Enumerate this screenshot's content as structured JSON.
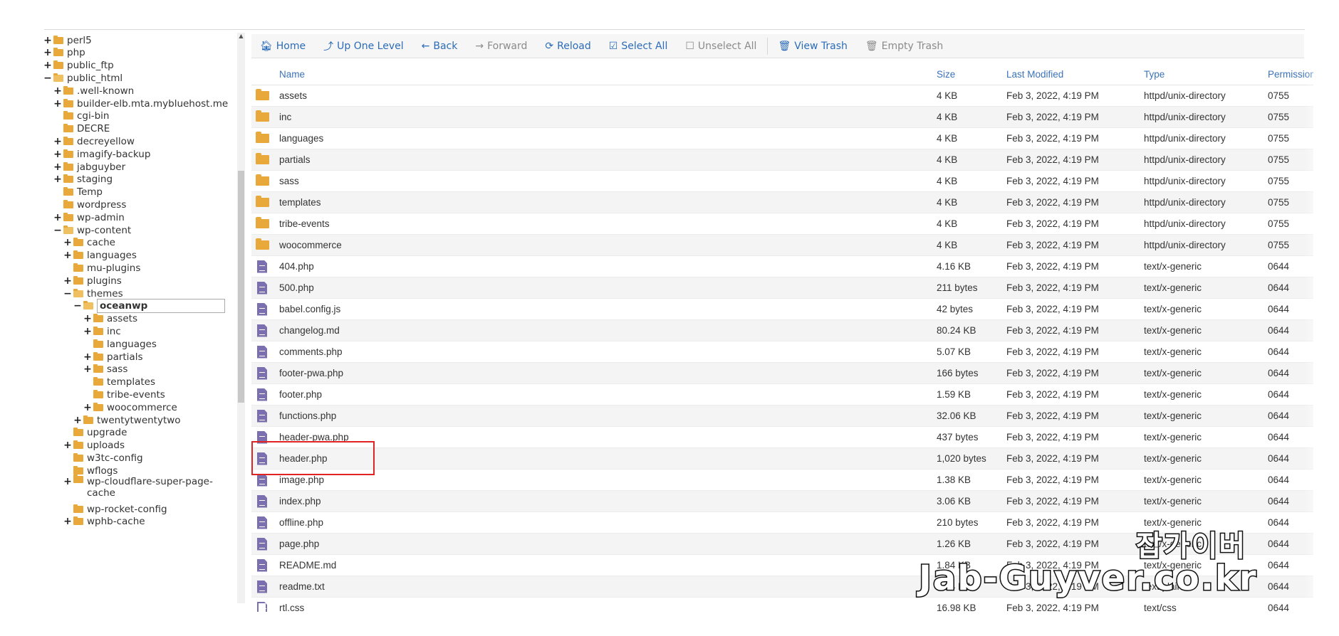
{
  "sidebar": {
    "tree": [
      {
        "label": "perl5",
        "toggle": "+",
        "depth": 0
      },
      {
        "label": "php",
        "toggle": "+",
        "depth": 0
      },
      {
        "label": "public_ftp",
        "toggle": "+",
        "depth": 0
      },
      {
        "label": "public_html",
        "toggle": "−",
        "depth": 0,
        "open": true
      },
      {
        "label": ".well-known",
        "toggle": "+",
        "depth": 1
      },
      {
        "label": "builder-elb.mta.mybluehost.me",
        "toggle": "+",
        "depth": 1
      },
      {
        "label": "cgi-bin",
        "toggle": "",
        "depth": 1
      },
      {
        "label": "DECRE",
        "toggle": "",
        "depth": 1
      },
      {
        "label": "decreyellow",
        "toggle": "+",
        "depth": 1
      },
      {
        "label": "imagify-backup",
        "toggle": "+",
        "depth": 1
      },
      {
        "label": "jabguyber",
        "toggle": "+",
        "depth": 1
      },
      {
        "label": "staging",
        "toggle": "+",
        "depth": 1
      },
      {
        "label": "Temp",
        "toggle": "",
        "depth": 1
      },
      {
        "label": "wordpress",
        "toggle": "",
        "depth": 1
      },
      {
        "label": "wp-admin",
        "toggle": "+",
        "depth": 1
      },
      {
        "label": "wp-content",
        "toggle": "−",
        "depth": 1,
        "open": true
      },
      {
        "label": "cache",
        "toggle": "+",
        "depth": 2
      },
      {
        "label": "languages",
        "toggle": "+",
        "depth": 2
      },
      {
        "label": "mu-plugins",
        "toggle": "",
        "depth": 2
      },
      {
        "label": "plugins",
        "toggle": "+",
        "depth": 2
      },
      {
        "label": "themes",
        "toggle": "−",
        "depth": 2,
        "open": true
      },
      {
        "label": "oceanwp",
        "toggle": "−",
        "depth": 3,
        "open": true,
        "selected": true
      },
      {
        "label": "assets",
        "toggle": "+",
        "depth": 4
      },
      {
        "label": "inc",
        "toggle": "+",
        "depth": 4
      },
      {
        "label": "languages",
        "toggle": "",
        "depth": 4
      },
      {
        "label": "partials",
        "toggle": "+",
        "depth": 4
      },
      {
        "label": "sass",
        "toggle": "+",
        "depth": 4
      },
      {
        "label": "templates",
        "toggle": "",
        "depth": 4
      },
      {
        "label": "tribe-events",
        "toggle": "",
        "depth": 4
      },
      {
        "label": "woocommerce",
        "toggle": "+",
        "depth": 4
      },
      {
        "label": "twentytwentytwo",
        "toggle": "+",
        "depth": 3
      },
      {
        "label": "upgrade",
        "toggle": "",
        "depth": 2
      },
      {
        "label": "uploads",
        "toggle": "+",
        "depth": 2
      },
      {
        "label": "w3tc-config",
        "toggle": "",
        "depth": 2
      },
      {
        "label": "wflogs",
        "toggle": "",
        "depth": 2
      },
      {
        "label": "wp-cloudflare-super-page-cache",
        "toggle": "+",
        "depth": 2,
        "two_line": true
      },
      {
        "label": "wp-rocket-config",
        "toggle": "",
        "depth": 2
      },
      {
        "label": "wphb-cache",
        "toggle": "+",
        "depth": 2
      }
    ]
  },
  "toolbar": {
    "home": "Home",
    "up": "Up One Level",
    "back": "Back",
    "forward": "Forward",
    "reload": "Reload",
    "select_all": "Select All",
    "unselect_all": "Unselect All",
    "view_trash": "View Trash",
    "empty_trash": "Empty Trash"
  },
  "table": {
    "headers": {
      "name": "Name",
      "size": "Size",
      "modified": "Last Modified",
      "type": "Type",
      "perm": "Permissions"
    },
    "rows": [
      {
        "kind": "dir",
        "name": "assets",
        "size": "4 KB",
        "modified": "Feb 3, 2022, 4:19 PM",
        "type": "httpd/unix-directory",
        "perm": "0755"
      },
      {
        "kind": "dir",
        "name": "inc",
        "size": "4 KB",
        "modified": "Feb 3, 2022, 4:19 PM",
        "type": "httpd/unix-directory",
        "perm": "0755"
      },
      {
        "kind": "dir",
        "name": "languages",
        "size": "4 KB",
        "modified": "Feb 3, 2022, 4:19 PM",
        "type": "httpd/unix-directory",
        "perm": "0755"
      },
      {
        "kind": "dir",
        "name": "partials",
        "size": "4 KB",
        "modified": "Feb 3, 2022, 4:19 PM",
        "type": "httpd/unix-directory",
        "perm": "0755"
      },
      {
        "kind": "dir",
        "name": "sass",
        "size": "4 KB",
        "modified": "Feb 3, 2022, 4:19 PM",
        "type": "httpd/unix-directory",
        "perm": "0755"
      },
      {
        "kind": "dir",
        "name": "templates",
        "size": "4 KB",
        "modified": "Feb 3, 2022, 4:19 PM",
        "type": "httpd/unix-directory",
        "perm": "0755"
      },
      {
        "kind": "dir",
        "name": "tribe-events",
        "size": "4 KB",
        "modified": "Feb 3, 2022, 4:19 PM",
        "type": "httpd/unix-directory",
        "perm": "0755"
      },
      {
        "kind": "dir",
        "name": "woocommerce",
        "size": "4 KB",
        "modified": "Feb 3, 2022, 4:19 PM",
        "type": "httpd/unix-directory",
        "perm": "0755"
      },
      {
        "kind": "file",
        "name": "404.php",
        "size": "4.16 KB",
        "modified": "Feb 3, 2022, 4:19 PM",
        "type": "text/x-generic",
        "perm": "0644"
      },
      {
        "kind": "file",
        "name": "500.php",
        "size": "211 bytes",
        "modified": "Feb 3, 2022, 4:19 PM",
        "type": "text/x-generic",
        "perm": "0644"
      },
      {
        "kind": "file",
        "name": "babel.config.js",
        "size": "42 bytes",
        "modified": "Feb 3, 2022, 4:19 PM",
        "type": "text/x-generic",
        "perm": "0644"
      },
      {
        "kind": "file",
        "name": "changelog.md",
        "size": "80.24 KB",
        "modified": "Feb 3, 2022, 4:19 PM",
        "type": "text/x-generic",
        "perm": "0644"
      },
      {
        "kind": "file",
        "name": "comments.php",
        "size": "5.07 KB",
        "modified": "Feb 3, 2022, 4:19 PM",
        "type": "text/x-generic",
        "perm": "0644"
      },
      {
        "kind": "file",
        "name": "footer-pwa.php",
        "size": "166 bytes",
        "modified": "Feb 3, 2022, 4:19 PM",
        "type": "text/x-generic",
        "perm": "0644"
      },
      {
        "kind": "file",
        "name": "footer.php",
        "size": "1.59 KB",
        "modified": "Feb 3, 2022, 4:19 PM",
        "type": "text/x-generic",
        "perm": "0644"
      },
      {
        "kind": "file",
        "name": "functions.php",
        "size": "32.06 KB",
        "modified": "Feb 3, 2022, 4:19 PM",
        "type": "text/x-generic",
        "perm": "0644"
      },
      {
        "kind": "file",
        "name": "header-pwa.php",
        "size": "437 bytes",
        "modified": "Feb 3, 2022, 4:19 PM",
        "type": "text/x-generic",
        "perm": "0644"
      },
      {
        "kind": "file",
        "name": "header.php",
        "size": "1,020 bytes",
        "modified": "Feb 3, 2022, 4:19 PM",
        "type": "text/x-generic",
        "perm": "0644",
        "highlighted": true
      },
      {
        "kind": "file",
        "name": "image.php",
        "size": "1.38 KB",
        "modified": "Feb 3, 2022, 4:19 PM",
        "type": "text/x-generic",
        "perm": "0644"
      },
      {
        "kind": "file",
        "name": "index.php",
        "size": "3.06 KB",
        "modified": "Feb 3, 2022, 4:19 PM",
        "type": "text/x-generic",
        "perm": "0644"
      },
      {
        "kind": "file",
        "name": "offline.php",
        "size": "210 bytes",
        "modified": "Feb 3, 2022, 4:19 PM",
        "type": "text/x-generic",
        "perm": "0644"
      },
      {
        "kind": "file",
        "name": "page.php",
        "size": "1.26 KB",
        "modified": "Feb 3, 2022, 4:19 PM",
        "type": "text/x-generic",
        "perm": "0644"
      },
      {
        "kind": "file",
        "name": "README.md",
        "size": "1.84 KB",
        "modified": "Feb 3, 2022, 4:19 PM",
        "type": "text/x-generic",
        "perm": "0644"
      },
      {
        "kind": "file",
        "name": "readme.txt",
        "size": "6.24 KB",
        "modified": "Feb 3, 2022, 4:19 PM",
        "type": "text/plain",
        "perm": "0644"
      },
      {
        "kind": "file-outline",
        "name": "rtl.css",
        "size": "16.98 KB",
        "modified": "Feb 3, 2022, 4:19 PM",
        "type": "text/css",
        "perm": "0644"
      }
    ]
  },
  "watermark": {
    "korean": "잡가이버",
    "url": "Jab-Guyver.co.kr"
  },
  "colors": {
    "link": "#2b6cb8",
    "folder": "#e8a93a",
    "file": "#7b6fb0",
    "highlight": "#e02424"
  }
}
